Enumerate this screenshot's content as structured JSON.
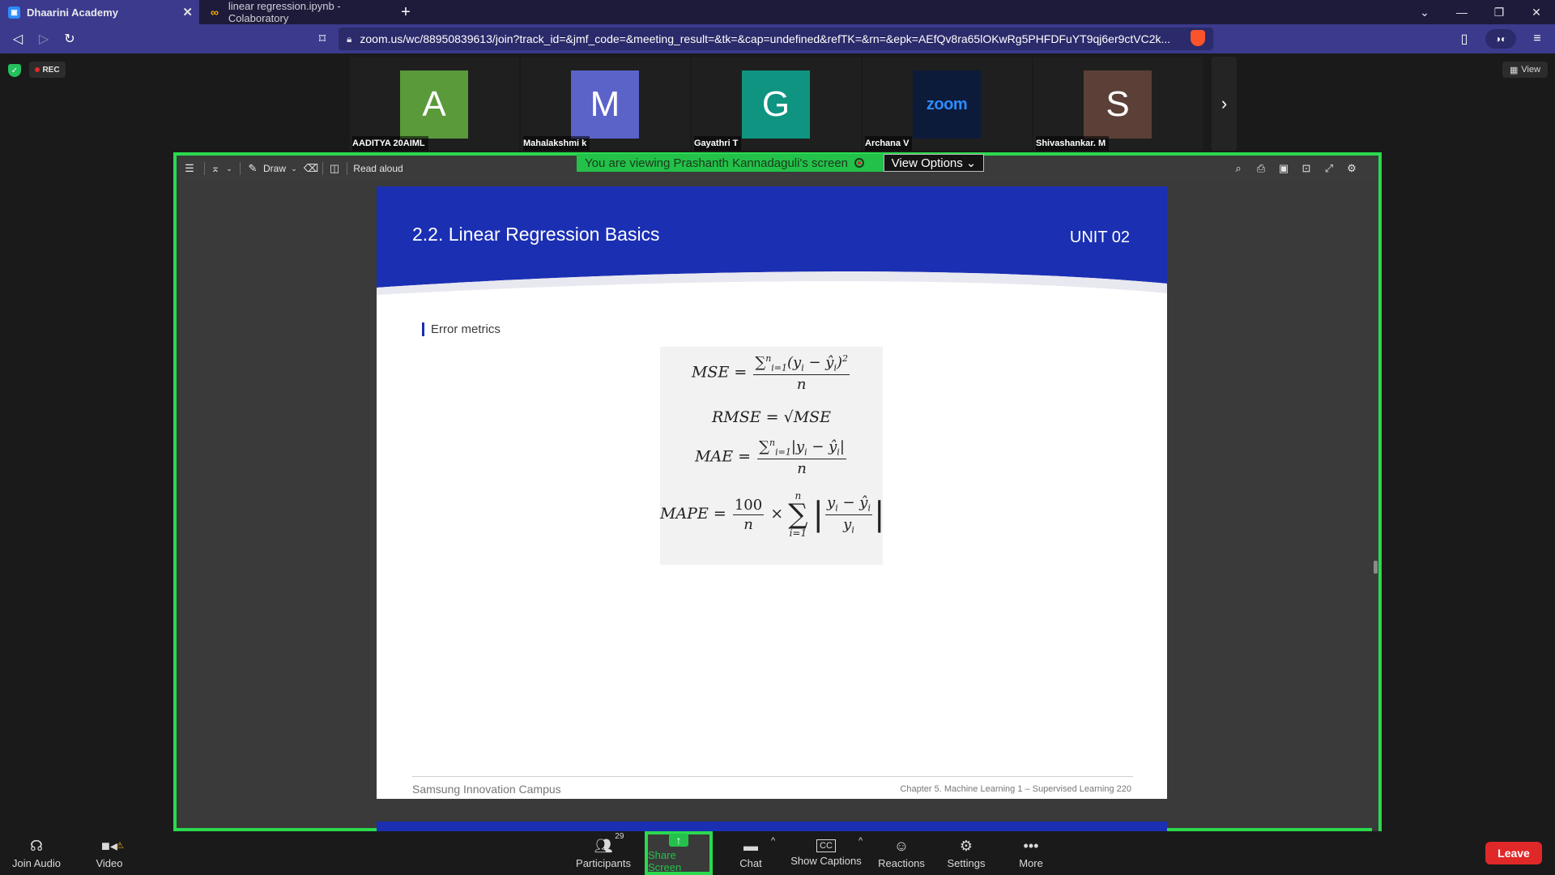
{
  "browser": {
    "tabs": [
      {
        "title": "Dhaarini Academy",
        "active": true
      },
      {
        "title": "linear regression.ipynb - Colaboratory",
        "active": false
      }
    ],
    "new_tab": "+",
    "url_host": "zoom.us",
    "url_path": "/wc/88950839613/join?track_id=&jmf_code=&meeting_result=&tk=&cap=undefined&refTK=&rn=&epk=AEfQv8ra65lOKwRg5PHFDFuYT9qj6er9ctVC2k..."
  },
  "meeting": {
    "rec_label": "REC",
    "view_label": "View",
    "participants": [
      {
        "initial": "A",
        "name": "AADITYA 20AIML",
        "color": "#5a9a3a"
      },
      {
        "initial": "M",
        "name": "Mahalakshmi k",
        "color": "#5b63c9"
      },
      {
        "initial": "G",
        "name": "Gayathri T",
        "color": "#0e9480"
      },
      {
        "initial": "zoom",
        "name": "Archana V",
        "color": "#0d1b3b"
      },
      {
        "initial": "S",
        "name": "Shivashankar. M",
        "color": "#5c3f36"
      }
    ],
    "viewing_banner": "You are viewing Prashanth Kannadaguli's screen",
    "view_options": "View Options"
  },
  "pdf_toolbar": {
    "draw": "Draw",
    "read_aloud": "Read aloud"
  },
  "slide": {
    "title": "2.2. Linear Regression Basics",
    "unit": "UNIT 02",
    "section_label": "Error metrics",
    "mse_lhs": "MSE =",
    "rmse": "RMSE = √MSE",
    "mae_lhs": "MAE =",
    "mape_lhs": "MAPE =",
    "footer_left": "Samsung Innovation Campus",
    "footer_right": "Chapter 5. Machine Learning 1 – Supervised Learning   220"
  },
  "footer": {
    "join_audio": "Join Audio",
    "video": "Video",
    "participants": "Participants",
    "participants_count": "29",
    "share_screen": "Share Screen",
    "chat": "Chat",
    "show_captions": "Show Captions",
    "reactions": "Reactions",
    "settings": "Settings",
    "more": "More",
    "leave": "Leave"
  }
}
